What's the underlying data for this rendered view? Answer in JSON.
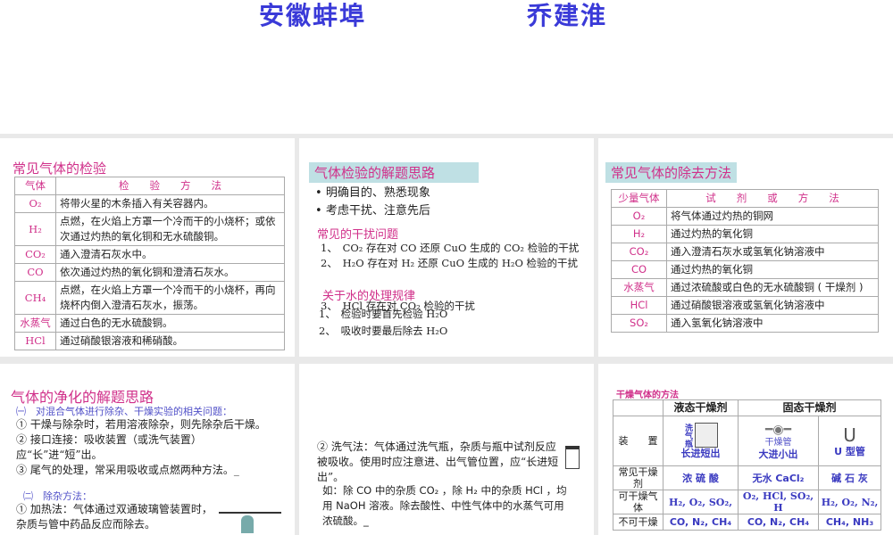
{
  "header": {
    "left": "安徽蚌埠",
    "right": "乔建淮"
  },
  "p1": {
    "title": "常见气体的检验",
    "cols": [
      "气体",
      "检　　验　　方　　法"
    ],
    "rows": [
      [
        "O₂",
        "将带火星的木条插入有关容器内。"
      ],
      [
        "H₂",
        "点燃，在火焰上方罩一个冷而干的小烧杯；或依次通过灼热的氧化铜和无水硫酸铜。"
      ],
      [
        "CO₂",
        "通入澄清石灰水中。"
      ],
      [
        "CO",
        "依次通过灼热的氧化铜和澄清石灰水。"
      ],
      [
        "CH₄",
        "点燃，在火焰上方罩一个冷而干的小烧杯，再向烧杯内倒入澄清石灰水，振荡。"
      ],
      [
        "水蒸气",
        "通过白色的无水硫酸铜。"
      ],
      [
        "HCl",
        "通过硝酸银溶液和稀硝酸。"
      ]
    ]
  },
  "p2": {
    "title": "气体检验的解题思路",
    "bullets": [
      "明确目的、熟悉现象",
      "考虑干扰、注意先后"
    ],
    "sub1": "常见的干扰问题",
    "items1": [
      "1、　CO₂ 存在对 CO 还原 CuO 生成的 CO₂ 检验的干扰",
      "2、　H₂O 存在对 H₂ 还原 CuO 生成的 H₂O 检验的干扰",
      "3、　HCl 存在对 CO₂ 检验的干扰"
    ],
    "sub2": "关于水的处理规律",
    "items2": [
      "1、　检验时要首先检验 H₂O",
      "2、　吸收时要最后除去 H₂O"
    ]
  },
  "p3": {
    "title": "常见气体的除去方法",
    "cols": [
      "少量气体",
      "试　　剂　　或　　方　　法"
    ],
    "rows": [
      [
        "O₂",
        "将气体通过灼热的铜网"
      ],
      [
        "H₂",
        "通过灼热的氧化铜"
      ],
      [
        "CO₂",
        "通入澄清石灰水或氢氧化钠溶液中"
      ],
      [
        "CO",
        "通过灼热的氧化铜"
      ],
      [
        "水蒸气",
        "通过浓硫酸或白色的无水硫酸铜 ( 干燥剂 )"
      ],
      [
        "HCl",
        "通过硝酸银溶液或氢氧化钠溶液中"
      ],
      [
        "SO₂",
        "通入氢氧化钠溶液中"
      ]
    ]
  },
  "p4": {
    "title": "气体的净化的解题思路",
    "sec1": "㈠　对混合气体进行除杂、干燥实验的相关问题：",
    "lines": [
      "① 干燥与除杂时，若用溶液除杂，则先除杂后干燥。",
      "② 接口连接：吸收装置（或洗气装置）应“长”进“短”出。",
      "③ 尾气的处理，常采用吸收或点燃两种方法。_"
    ],
    "sec2": "㈡　除杂方法：",
    "line4": "① 加热法：气体通过双通玻璃管装置时，杂质与管中药品反应而除去。"
  },
  "p5": {
    "para1": "② 洗气法：气体通过洗气瓶，杂质与瓶中试剂反应被吸收。使用时应注意进、出气管位置，应“长进短出”。",
    "para2": "如：除 CO 中的杂质 CO₂ ，除 H₂ 中的杂质 HCl ，均用 NaOH 溶液。除去酸性、中性气体中的水蒸气可用浓硫酸。_"
  },
  "p6": {
    "title": "干燥气体的方法",
    "liquid": "液态干燥剂",
    "solid": "固态干燥剂",
    "device_label": "装　　置",
    "bottle": "洗气瓶",
    "bottle_rule": "长进短出",
    "tube": "干燥管",
    "tube_rule": "大进小出",
    "utube": "U 型管",
    "agent_label": "常见干燥剂",
    "agents": [
      "浓 硫 酸",
      "无水 CaCl₂",
      "碱 石 灰"
    ],
    "gas_label": "可干燥气体",
    "gases": [
      "H₂, O₂, SO₂,",
      "O₂, HCl, SO₂, H",
      "H₂, O₂, N₂,"
    ],
    "no_label": "不可干燥",
    "no": [
      "CO, N₂, CH₄",
      "CO, N₂, CH₄",
      "CH₄, NH₃"
    ]
  }
}
